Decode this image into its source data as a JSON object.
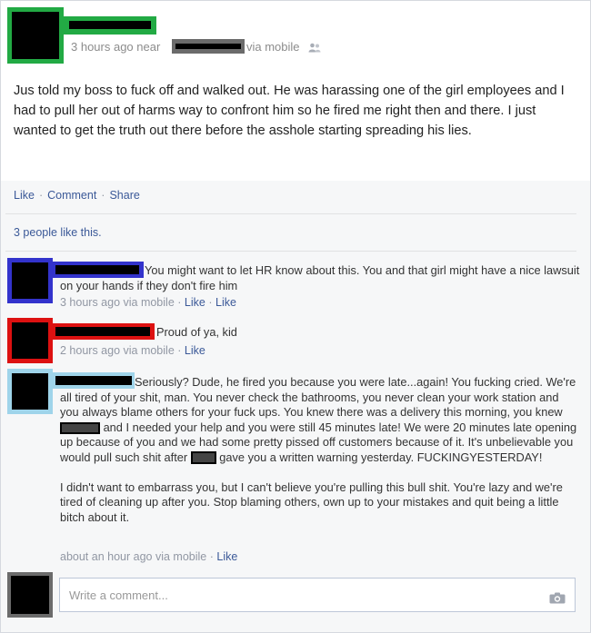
{
  "post": {
    "time": "3 hours ago near",
    "via": "via mobile",
    "audience_icon": "friends-icon",
    "text": "Jus told my boss to fuck off and walked out. He was harassing one of the girl employees and I had to pull her out of harms way to confront him so he fired me right then and there. I just wanted to get the truth out there before the asshole starting spreading his lies."
  },
  "actions": {
    "like": "Like",
    "comment": "Comment",
    "share": "Share",
    "sep": "·"
  },
  "likes_text": "3 people like this.",
  "comments": [
    {
      "text": "You might want to let HR know about this. You and that girl might have a nice lawsuit on your hands if they don't fire him",
      "time": "3 hours ago via mobile",
      "like": "Like",
      "like2": "Like",
      "frame_color": "#3333cc"
    },
    {
      "text": "Proud of ya, kid",
      "time": "2 hours ago via mobile",
      "like": "Like",
      "frame_color": "#dd1111"
    },
    {
      "text_a": "Seriously? Dude, he fired you because you were late...again! You fucking cried. We're all tired of your shit, man. You never check the bathrooms, you never clean your work station and you always blame others for your fuck ups. You knew there was a delivery this morning, you knew",
      "text_b": "and I needed your help and you were still 45 minutes late! We were 20 minutes late opening up because of you and we had some pretty pissed off customers because of it. It's unbelievable you would pull such shit after",
      "text_c": "gave you a written warning yesterday. FUCKINGYESTERDAY!",
      "text_d": "I didn't want to embarrass you, but I can't believe you're pulling this bull shit. You're lazy and we're tired of cleaning up after you. Stop blaming others, own up to your mistakes and quit being a little bitch about it.",
      "time": "about an hour ago via mobile",
      "like": "Like",
      "frame_color": "#9fd4ea"
    }
  ],
  "composer": {
    "placeholder": "Write a comment...",
    "camera_icon": "camera-icon"
  },
  "colors": {
    "link": "#3b5998",
    "poster_frame": "#22aa44",
    "meta": "#9197a3"
  }
}
